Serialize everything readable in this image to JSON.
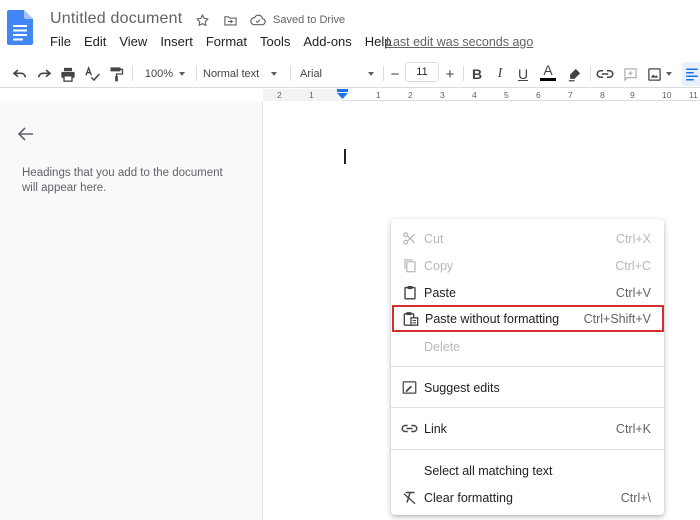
{
  "title_bar": {
    "doc_title": "Untitled document",
    "saved_status": "Saved to Drive"
  },
  "menu": [
    "File",
    "Edit",
    "View",
    "Insert",
    "Format",
    "Tools",
    "Add-ons",
    "Help"
  ],
  "last_edit": "Last edit was seconds ago",
  "toolbar": {
    "zoom": "100%",
    "style": "Normal text",
    "font": "Arial",
    "font_size": "11",
    "minus": "−",
    "plus": "+",
    "bold": "B",
    "italic": "I",
    "underline": "U",
    "text_color": "A",
    "icons": [
      "undo-icon",
      "redo-icon",
      "print-icon",
      "spellcheck-icon",
      "paint-format-icon",
      "highlighter-icon",
      "link-icon",
      "comment-icon",
      "image-icon",
      "align-left-icon"
    ]
  },
  "ruler": {
    "numbers": [
      "2",
      "1",
      "1",
      "2",
      "3",
      "4",
      "5",
      "6",
      "7",
      "8",
      "9",
      "10",
      "11"
    ]
  },
  "outline": {
    "help_text": "Headings that you add to the document will appear here."
  },
  "context_menu": {
    "items": [
      {
        "label": "Cut",
        "shortcut": "Ctrl+X",
        "enabled": false,
        "icon": "scissors-icon"
      },
      {
        "label": "Copy",
        "shortcut": "Ctrl+C",
        "enabled": false,
        "icon": "copy-icon"
      },
      {
        "label": "Paste",
        "shortcut": "Ctrl+V",
        "enabled": true,
        "icon": "clipboard-icon"
      },
      {
        "label": "Paste without formatting",
        "shortcut": "Ctrl+Shift+V",
        "enabled": true,
        "icon": "paste-plain-icon",
        "highlighted": true
      },
      {
        "label": "Delete",
        "shortcut": "",
        "enabled": false,
        "icon": ""
      },
      {
        "label": "Suggest edits",
        "shortcut": "",
        "enabled": true,
        "icon": "suggest-edits-icon"
      },
      {
        "label": "Link",
        "shortcut": "Ctrl+K",
        "enabled": true,
        "icon": "link-icon"
      },
      {
        "label": "Select all matching text",
        "shortcut": "",
        "enabled": true,
        "icon": ""
      },
      {
        "label": "Clear formatting",
        "shortcut": "Ctrl+\\",
        "enabled": true,
        "icon": "clear-formatting-icon"
      }
    ],
    "highlight_color": "#d32f2f"
  },
  "colors": {
    "docs_blue": "#4285f4",
    "active_blue": "#1a73e8",
    "panel_bg": "#f8f9fa"
  }
}
